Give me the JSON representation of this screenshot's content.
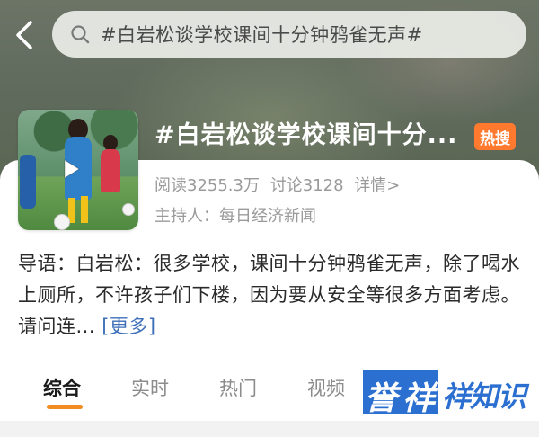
{
  "search": {
    "query": "#白岩松谈学校课间十分钟鸦雀无声#"
  },
  "topic": {
    "title": "#白岩松谈学校课间十分...",
    "badge": "热搜",
    "reads": "阅读3255.3万",
    "discussions": "讨论3128",
    "details_link": "详情>",
    "host": "主持人：每日经济新闻"
  },
  "intro": {
    "text": "导语：白岩松：很多学校，课间十分钟鸦雀无声，除了喝水上厕所，不许孩子们下楼，因为要从安全等很多方面考虑。请问连...",
    "more_link": "[更多]"
  },
  "tabs": [
    {
      "label": "综合",
      "active": true
    },
    {
      "label": "实时",
      "active": false
    },
    {
      "label": "热门",
      "active": false
    },
    {
      "label": "视频",
      "active": false
    }
  ],
  "watermark": {
    "char1": "誉",
    "char2": "祥",
    "rest": "祥知识"
  },
  "colors": {
    "accent": "#f08c22",
    "hot_badge": "#ff7a2f",
    "link": "#3c6fb8",
    "watermark_blue": "#2b6fd0"
  },
  "icons": [
    "back-arrow-icon",
    "search-icon",
    "play-icon"
  ]
}
